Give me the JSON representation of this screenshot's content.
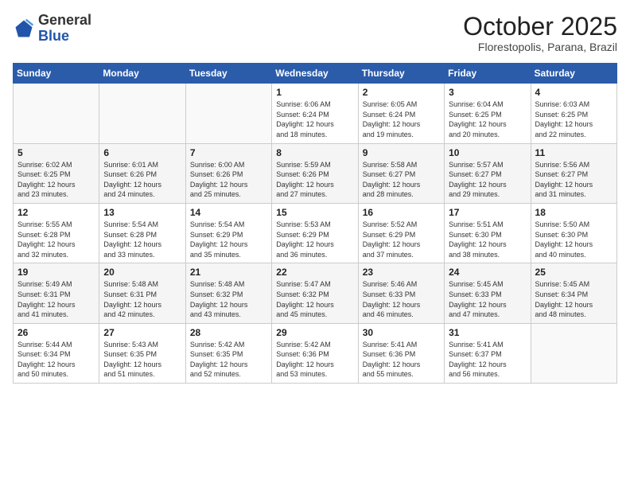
{
  "header": {
    "logo_general": "General",
    "logo_blue": "Blue",
    "month_title": "October 2025",
    "location": "Florestopolis, Parana, Brazil"
  },
  "weekdays": [
    "Sunday",
    "Monday",
    "Tuesday",
    "Wednesday",
    "Thursday",
    "Friday",
    "Saturday"
  ],
  "weeks": [
    [
      {
        "day": "",
        "info": ""
      },
      {
        "day": "",
        "info": ""
      },
      {
        "day": "",
        "info": ""
      },
      {
        "day": "1",
        "info": "Sunrise: 6:06 AM\nSunset: 6:24 PM\nDaylight: 12 hours\nand 18 minutes."
      },
      {
        "day": "2",
        "info": "Sunrise: 6:05 AM\nSunset: 6:24 PM\nDaylight: 12 hours\nand 19 minutes."
      },
      {
        "day": "3",
        "info": "Sunrise: 6:04 AM\nSunset: 6:25 PM\nDaylight: 12 hours\nand 20 minutes."
      },
      {
        "day": "4",
        "info": "Sunrise: 6:03 AM\nSunset: 6:25 PM\nDaylight: 12 hours\nand 22 minutes."
      }
    ],
    [
      {
        "day": "5",
        "info": "Sunrise: 6:02 AM\nSunset: 6:25 PM\nDaylight: 12 hours\nand 23 minutes."
      },
      {
        "day": "6",
        "info": "Sunrise: 6:01 AM\nSunset: 6:26 PM\nDaylight: 12 hours\nand 24 minutes."
      },
      {
        "day": "7",
        "info": "Sunrise: 6:00 AM\nSunset: 6:26 PM\nDaylight: 12 hours\nand 25 minutes."
      },
      {
        "day": "8",
        "info": "Sunrise: 5:59 AM\nSunset: 6:26 PM\nDaylight: 12 hours\nand 27 minutes."
      },
      {
        "day": "9",
        "info": "Sunrise: 5:58 AM\nSunset: 6:27 PM\nDaylight: 12 hours\nand 28 minutes."
      },
      {
        "day": "10",
        "info": "Sunrise: 5:57 AM\nSunset: 6:27 PM\nDaylight: 12 hours\nand 29 minutes."
      },
      {
        "day": "11",
        "info": "Sunrise: 5:56 AM\nSunset: 6:27 PM\nDaylight: 12 hours\nand 31 minutes."
      }
    ],
    [
      {
        "day": "12",
        "info": "Sunrise: 5:55 AM\nSunset: 6:28 PM\nDaylight: 12 hours\nand 32 minutes."
      },
      {
        "day": "13",
        "info": "Sunrise: 5:54 AM\nSunset: 6:28 PM\nDaylight: 12 hours\nand 33 minutes."
      },
      {
        "day": "14",
        "info": "Sunrise: 5:54 AM\nSunset: 6:29 PM\nDaylight: 12 hours\nand 35 minutes."
      },
      {
        "day": "15",
        "info": "Sunrise: 5:53 AM\nSunset: 6:29 PM\nDaylight: 12 hours\nand 36 minutes."
      },
      {
        "day": "16",
        "info": "Sunrise: 5:52 AM\nSunset: 6:29 PM\nDaylight: 12 hours\nand 37 minutes."
      },
      {
        "day": "17",
        "info": "Sunrise: 5:51 AM\nSunset: 6:30 PM\nDaylight: 12 hours\nand 38 minutes."
      },
      {
        "day": "18",
        "info": "Sunrise: 5:50 AM\nSunset: 6:30 PM\nDaylight: 12 hours\nand 40 minutes."
      }
    ],
    [
      {
        "day": "19",
        "info": "Sunrise: 5:49 AM\nSunset: 6:31 PM\nDaylight: 12 hours\nand 41 minutes."
      },
      {
        "day": "20",
        "info": "Sunrise: 5:48 AM\nSunset: 6:31 PM\nDaylight: 12 hours\nand 42 minutes."
      },
      {
        "day": "21",
        "info": "Sunrise: 5:48 AM\nSunset: 6:32 PM\nDaylight: 12 hours\nand 43 minutes."
      },
      {
        "day": "22",
        "info": "Sunrise: 5:47 AM\nSunset: 6:32 PM\nDaylight: 12 hours\nand 45 minutes."
      },
      {
        "day": "23",
        "info": "Sunrise: 5:46 AM\nSunset: 6:33 PM\nDaylight: 12 hours\nand 46 minutes."
      },
      {
        "day": "24",
        "info": "Sunrise: 5:45 AM\nSunset: 6:33 PM\nDaylight: 12 hours\nand 47 minutes."
      },
      {
        "day": "25",
        "info": "Sunrise: 5:45 AM\nSunset: 6:34 PM\nDaylight: 12 hours\nand 48 minutes."
      }
    ],
    [
      {
        "day": "26",
        "info": "Sunrise: 5:44 AM\nSunset: 6:34 PM\nDaylight: 12 hours\nand 50 minutes."
      },
      {
        "day": "27",
        "info": "Sunrise: 5:43 AM\nSunset: 6:35 PM\nDaylight: 12 hours\nand 51 minutes."
      },
      {
        "day": "28",
        "info": "Sunrise: 5:42 AM\nSunset: 6:35 PM\nDaylight: 12 hours\nand 52 minutes."
      },
      {
        "day": "29",
        "info": "Sunrise: 5:42 AM\nSunset: 6:36 PM\nDaylight: 12 hours\nand 53 minutes."
      },
      {
        "day": "30",
        "info": "Sunrise: 5:41 AM\nSunset: 6:36 PM\nDaylight: 12 hours\nand 55 minutes."
      },
      {
        "day": "31",
        "info": "Sunrise: 5:41 AM\nSunset: 6:37 PM\nDaylight: 12 hours\nand 56 minutes."
      },
      {
        "day": "",
        "info": ""
      }
    ]
  ]
}
